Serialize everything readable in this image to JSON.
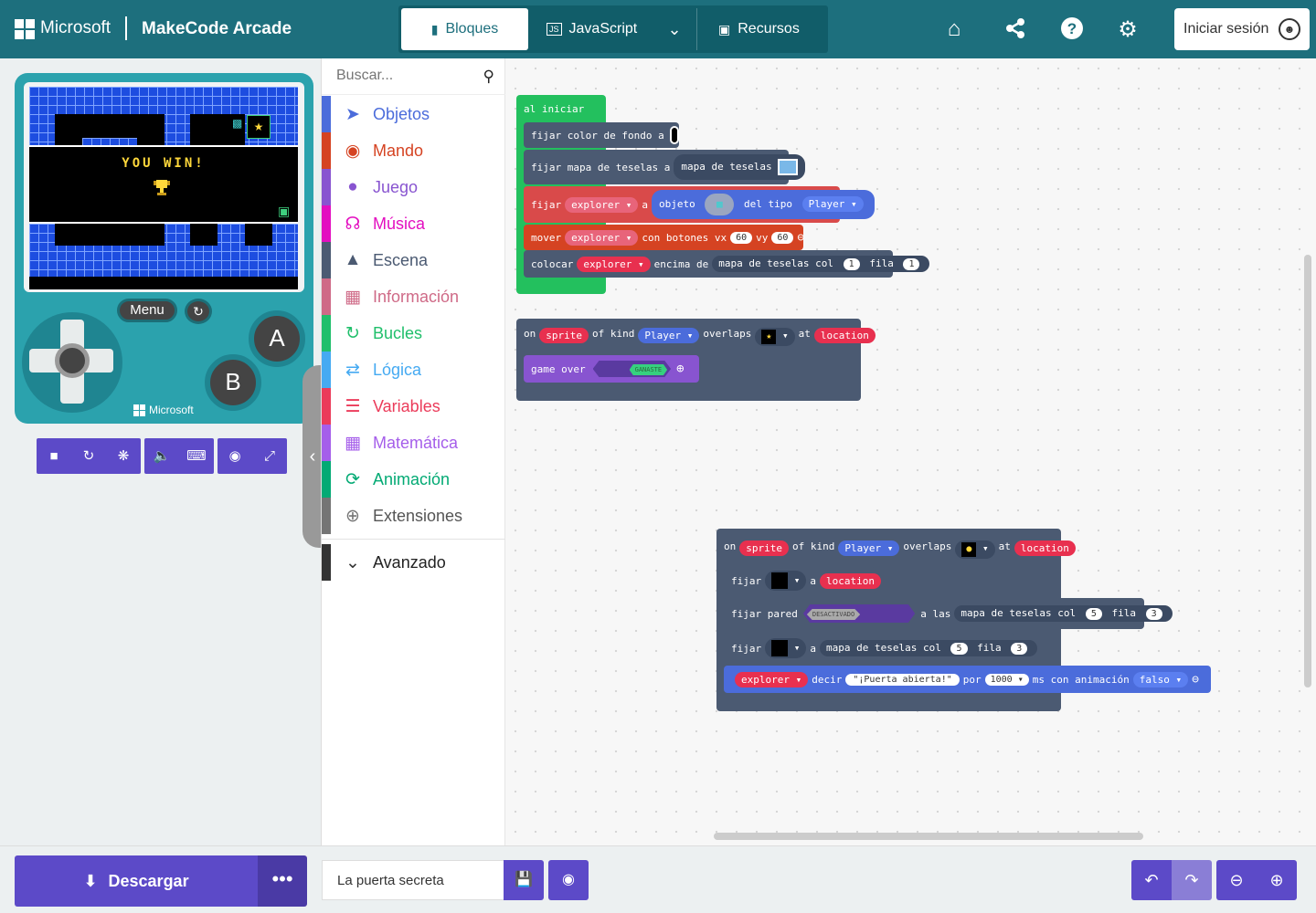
{
  "header": {
    "brand": "Microsoft",
    "app_name": "MakeCode Arcade",
    "tabs": [
      {
        "label": "Bloques",
        "active": true
      },
      {
        "label": "JavaScript",
        "active": false
      },
      {
        "label": "Recursos",
        "active": false
      }
    ],
    "icons": [
      "home-icon",
      "share-icon",
      "help-icon",
      "gear-icon"
    ],
    "signin_label": "Iniciar sesión",
    "color": "#1d6f7d"
  },
  "simulator": {
    "game_text": "YOU WIN!",
    "menu_label": "Menu",
    "button_a": "A",
    "button_b": "B",
    "console_brand": "Microsoft",
    "toolbar_icons": [
      "stop-icon",
      "restart-icon",
      "debug-icon",
      "sound-icon",
      "keyboard-icon",
      "screenshot-icon",
      "fullscreen-icon"
    ]
  },
  "toolbox": {
    "search_placeholder": "Buscar...",
    "categories": [
      {
        "label": "Objetos",
        "color": "#4b6cdb",
        "icon": "paper-plane-icon"
      },
      {
        "label": "Mando",
        "color": "#d54322",
        "icon": "gamepad-icon"
      },
      {
        "label": "Juego",
        "color": "#8854d0",
        "icon": "circle-icon"
      },
      {
        "label": "Música",
        "color": "#e30fc0",
        "icon": "headphones-icon"
      },
      {
        "label": "Escena",
        "color": "#4b5a72",
        "icon": "tree-icon"
      },
      {
        "label": "Información",
        "color": "#cf6a87",
        "icon": "id-card-icon"
      },
      {
        "label": "Bucles",
        "color": "#20bf6b",
        "icon": "loop-icon"
      },
      {
        "label": "Lógica",
        "color": "#45aaf2",
        "icon": "shuffle-icon"
      },
      {
        "label": "Variables",
        "color": "#eb3b5a",
        "icon": "list-icon"
      },
      {
        "label": "Matemática",
        "color": "#a55eea",
        "icon": "calculator-icon"
      },
      {
        "label": "Animación",
        "color": "#03aa74",
        "icon": "refresh-icon"
      },
      {
        "label": "Extensiones",
        "color": "#757575",
        "icon": "plus-circle-icon"
      },
      {
        "label": "Avanzado",
        "color": "#333333",
        "icon": "chevron-down-icon"
      }
    ]
  },
  "workspace": {
    "on_start": {
      "hat": "al iniciar",
      "set_bg": "fijar color de fondo a",
      "set_tilemap": "fijar mapa de teselas a",
      "tilemap": "mapa de teselas",
      "set": "fijar",
      "var_explorer": "explorer",
      "to": "a",
      "sprite_of": "objeto",
      "of_kind": "del tipo",
      "kind_player": "Player",
      "move": "mover",
      "with_buttons_vx": "con botones vx",
      "vx": "60",
      "vy_label": "vy",
      "vy": "60",
      "place": "colocar",
      "on_top_of": "encima de",
      "tilemap_col": "mapa de teselas col",
      "col": "1",
      "row_label": "fila",
      "row": "1"
    },
    "overlap1": {
      "on": "on",
      "sprite": "sprite",
      "of_kind": "of kind",
      "kind": "Player",
      "overlaps": "overlaps",
      "at": "at",
      "location": "location",
      "game_over": "game over",
      "ganaste": "GANASTE"
    },
    "overlap2": {
      "on": "on",
      "sprite": "sprite",
      "of_kind": "of kind",
      "kind": "Player",
      "overlaps": "overlaps",
      "at": "at",
      "location": "location",
      "set": "fijar",
      "to": "a",
      "set_wall": "fijar pared",
      "off": "DESACTIVADO",
      "at_the": "a las",
      "tilemap_col": "mapa de teselas col",
      "col": "5",
      "row_label": "fila",
      "row": "3",
      "explorer": "explorer",
      "say": "decir",
      "message": "¡Puerta abierta!",
      "for": "por",
      "ms_value": "1000",
      "ms_anim": "ms con animación",
      "anim_value": "falso"
    }
  },
  "bottom": {
    "download_label": "Descargar",
    "project_name": "La puerta secreta",
    "icons": [
      "undo-icon",
      "redo-icon",
      "zoom-out-icon",
      "zoom-in-icon"
    ]
  }
}
